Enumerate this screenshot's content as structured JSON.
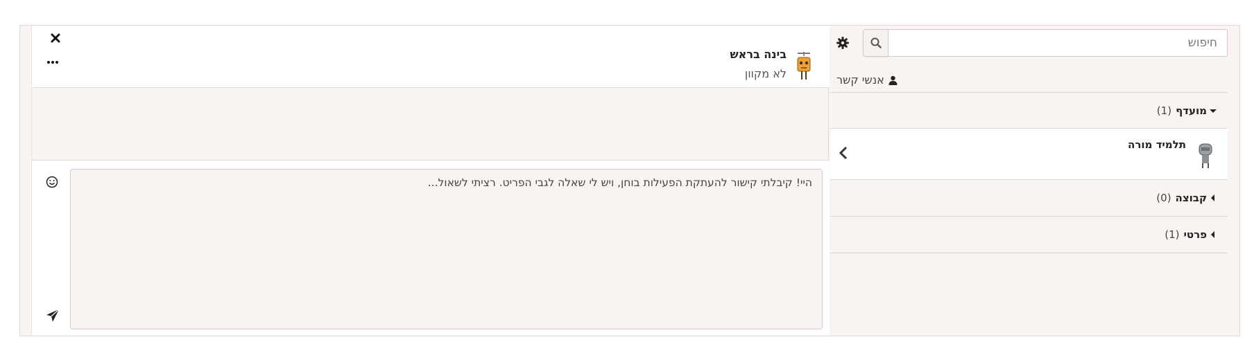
{
  "contacts": {
    "search_placeholder": "חיפוש",
    "contacts_label": "אנשי קשר",
    "sections": [
      {
        "title": "מועדף",
        "count": "(1)",
        "expanded": true
      },
      {
        "title": "קבוצה",
        "count": "(0)",
        "expanded": false
      },
      {
        "title": "פרטי",
        "count": "(1)",
        "expanded": false
      }
    ],
    "starred_contact": {
      "name": "תלמיד מורה"
    }
  },
  "conversation": {
    "user_name": "בינה בראש",
    "user_status": "לא מקוון",
    "message_draft": "היי! קיבלתי קישור להעתקת הפעילות בוחן, ויש לי שאלה לגבי הפריט. רציתי לשאול..."
  },
  "icons": {
    "search": "search-icon",
    "settings": "gear-icon",
    "contacts": "user-icon",
    "close": "close-icon",
    "more": "more-icon",
    "emoji": "emoji-icon",
    "send": "send-icon",
    "chevron": "chevron-left-icon"
  },
  "colors": {
    "panel_background": "#f9f4f2",
    "border": "#e2d9d6",
    "text": "#333333"
  }
}
